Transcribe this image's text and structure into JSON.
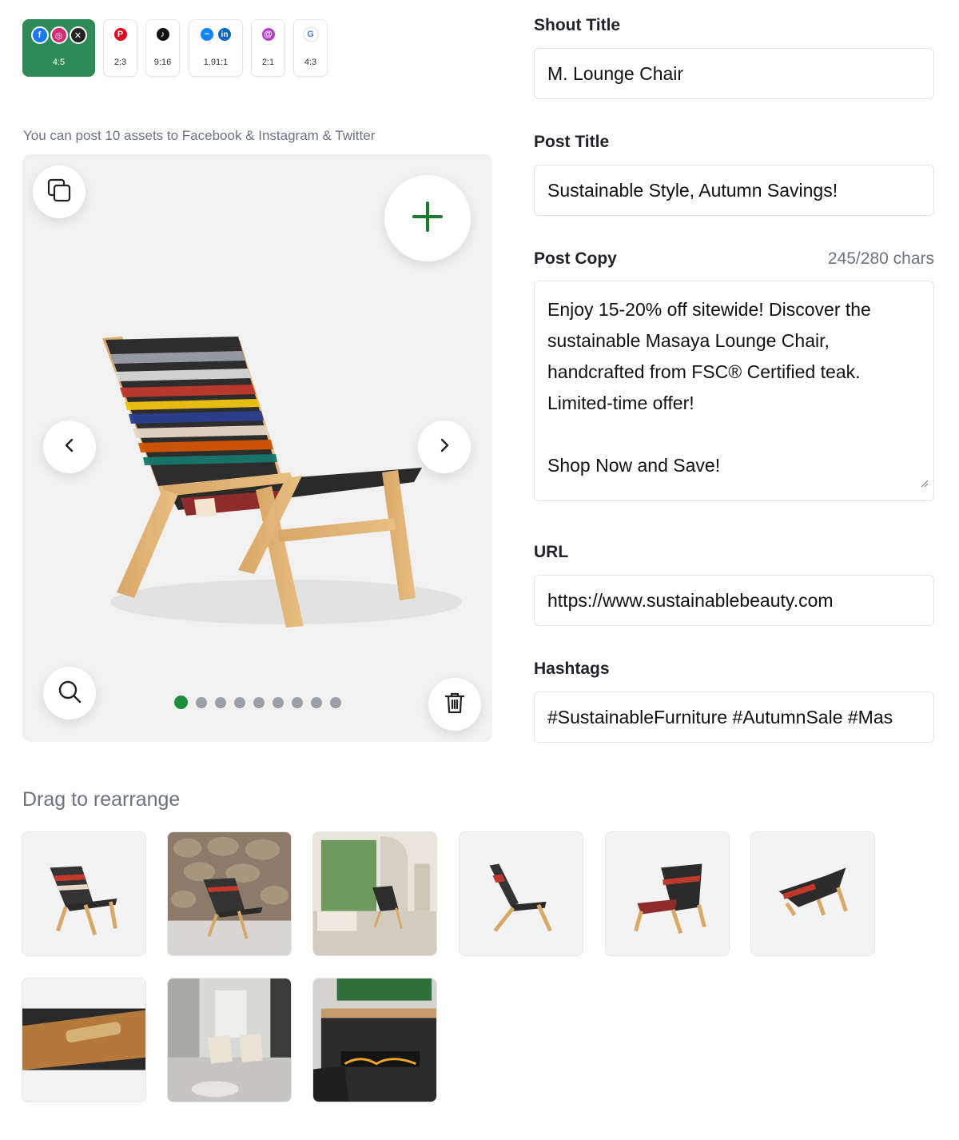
{
  "platform_chips": [
    {
      "ratio": "4:5",
      "icons": [
        "facebook-icon",
        "instagram-icon",
        "x-icon"
      ],
      "active": true
    },
    {
      "ratio": "2:3",
      "icons": [
        "pinterest-icon"
      ],
      "active": false
    },
    {
      "ratio": "9:16",
      "icons": [
        "tiktok-icon"
      ],
      "active": false
    },
    {
      "ratio": "1.91:1",
      "icons": [
        "bluesky-icon",
        "linkedin-icon"
      ],
      "active": false
    },
    {
      "ratio": "2:1",
      "icons": [
        "threads-icon"
      ],
      "active": false
    },
    {
      "ratio": "4:3",
      "icons": [
        "google-icon"
      ],
      "active": false
    }
  ],
  "asset_hint": "You can post 10 assets to Facebook & Instagram & Twitter",
  "preview": {
    "page_count": 9,
    "current_page": 1,
    "icons": [
      "copy-icon",
      "plus-icon",
      "chevron-left-icon",
      "chevron-right-icon",
      "zoom-icon",
      "trash-icon"
    ]
  },
  "form": {
    "shout_title_label": "Shout Title",
    "shout_title_value": "M. Lounge Chair",
    "post_title_label": "Post Title",
    "post_title_value": "Sustainable Style, Autumn Savings!",
    "post_copy_label": "Post Copy",
    "post_copy_counter": "245/280 chars",
    "post_copy_lines": [
      "Enjoy 15-20% off sitewide! Discover the",
      "sustainable Masaya Lounge Chair,",
      "handcrafted from FSC® Certified teak.",
      "Limited-time offer!",
      "Shop Now and Save!"
    ],
    "url_label": "URL",
    "url_value": "https://www.sustainablebeauty.com",
    "hashtags_label": "Hashtags",
    "hashtags_value": "#SustainableFurniture #AutumnSale #Mas"
  },
  "gallery": {
    "title": "Drag to rearrange",
    "thumbnails": [
      {
        "name": "chair-studio-front"
      },
      {
        "name": "chair-stone-wall"
      },
      {
        "name": "chair-living-room-window"
      },
      {
        "name": "chair-side-view"
      },
      {
        "name": "chair-back-three-quarter"
      },
      {
        "name": "chair-top-angle"
      },
      {
        "name": "brand-plate-closeup"
      },
      {
        "name": "chairs-interior-pair"
      },
      {
        "name": "chair-fireplace"
      }
    ]
  },
  "colors": {
    "accent_green": "#2e8b57",
    "dot_active": "#1e8e3e",
    "muted_text": "#6b7280"
  }
}
